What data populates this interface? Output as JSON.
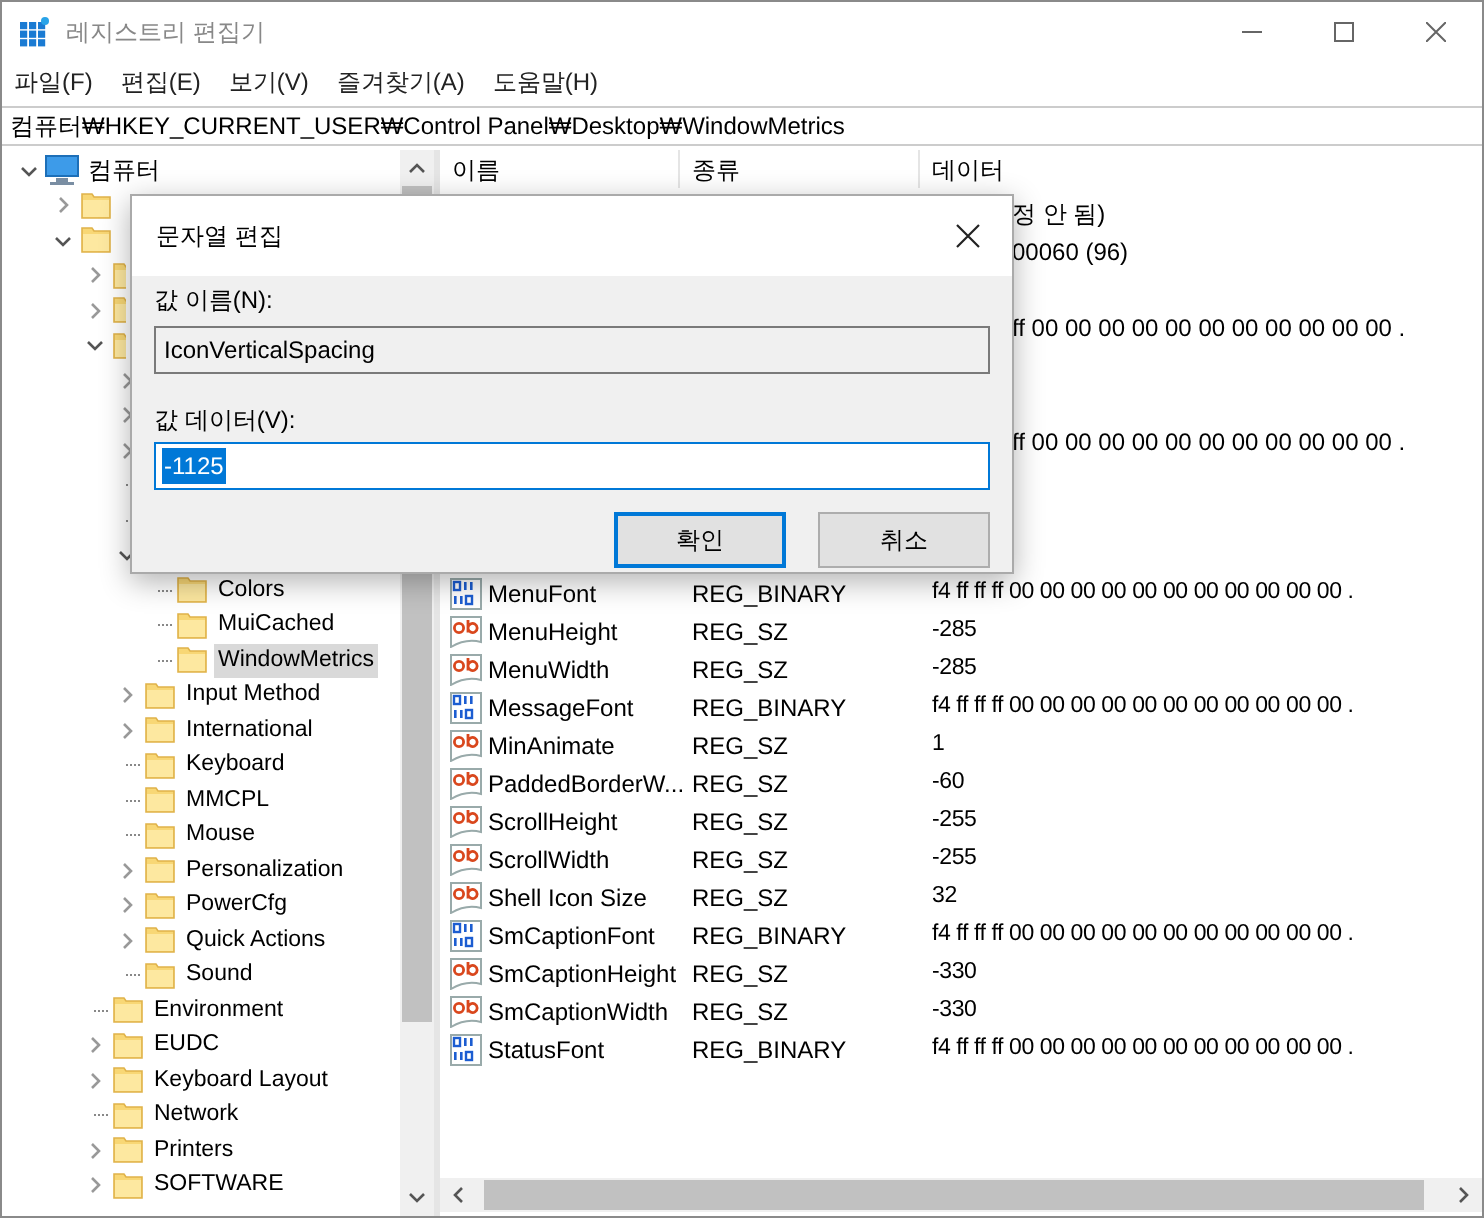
{
  "window": {
    "title": "레지스트리 편집기"
  },
  "menu": [
    "파일(F)",
    "편집(E)",
    "보기(V)",
    "즐겨찾기(A)",
    "도움말(H)"
  ],
  "address": "컴퓨터₩HKEY_CURRENT_USER₩Control Panel₩Desktop₩WindowMetrics",
  "tree": {
    "root": {
      "label": "컴퓨터",
      "expanded": true
    },
    "items": [
      {
        "expanded": false
      },
      {
        "expanded": true,
        "children": [
          {
            "expanded": false
          },
          {
            "expanded": false
          },
          {
            "expanded": true,
            "children": [
              {
                "expanded": false
              },
              {
                "expanded": false
              },
              {
                "expanded": false
              },
              {
                "leaf": true
              },
              {
                "leaf": true
              },
              {
                "expanded": true,
                "children": [
                  {
                    "label": "Colors",
                    "selected": false
                  },
                  {
                    "label": "MuiCached",
                    "selected": false
                  },
                  {
                    "label": "WindowMetrics",
                    "selected": true
                  }
                ]
              },
              {
                "label": "Input Method",
                "expanded": false,
                "selected": false
              },
              {
                "label": "International",
                "expanded": false,
                "selected": false
              },
              {
                "label": "Keyboard",
                "selected": false
              },
              {
                "label": "MMCPL",
                "selected": false
              },
              {
                "label": "Mouse",
                "selected": false
              },
              {
                "label": "Personalization",
                "expanded": false,
                "selected": false
              },
              {
                "label": "PowerCfg",
                "expanded": false,
                "selected": false
              },
              {
                "label": "Quick Actions",
                "expanded": false,
                "selected": false
              },
              {
                "label": "Sound",
                "selected": false
              }
            ]
          },
          {
            "label": "Environment",
            "selected": false
          },
          {
            "label": "EUDC",
            "expanded": false,
            "selected": false
          },
          {
            "label": "Keyboard Layout",
            "expanded": false,
            "selected": false
          },
          {
            "label": "Network",
            "selected": false
          },
          {
            "label": "Printers",
            "expanded": false,
            "selected": false
          },
          {
            "label": "SOFTWARE",
            "expanded": false,
            "selected": false
          }
        ]
      }
    ]
  },
  "table": {
    "columns": [
      "이름",
      "종류",
      "데이터"
    ],
    "rows": [
      {
        "kind": "covered",
        "data": "정 안 됨)"
      },
      {
        "kind": "covered",
        "data": "00060 (96)"
      },
      {
        "kind": "covered"
      },
      {
        "kind": "covered",
        "data": "ff 00 00 00 00 00 00 00 00 00 00 00 ."
      },
      {
        "kind": "covered"
      },
      {
        "kind": "covered"
      },
      {
        "kind": "covered",
        "data": "ff 00 00 00 00 00 00 00 00 00 00 00 ."
      },
      {
        "kind": "covered"
      },
      {
        "kind": "covered"
      },
      {
        "kind": "covered"
      },
      {
        "kind": "binary",
        "name": "MenuFont",
        "type": "REG_BINARY",
        "data": "f4 ff ff ff 00 00 00 00 00 00 00 00 00 00 00 ."
      },
      {
        "kind": "string",
        "name": "MenuHeight",
        "type": "REG_SZ",
        "data": "-285"
      },
      {
        "kind": "string",
        "name": "MenuWidth",
        "type": "REG_SZ",
        "data": "-285"
      },
      {
        "kind": "binary",
        "name": "MessageFont",
        "type": "REG_BINARY",
        "data": "f4 ff ff ff 00 00 00 00 00 00 00 00 00 00 00 ."
      },
      {
        "kind": "string",
        "name": "MinAnimate",
        "type": "REG_SZ",
        "data": "1"
      },
      {
        "kind": "string",
        "name": "PaddedBorderW...",
        "type": "REG_SZ",
        "data": "-60"
      },
      {
        "kind": "string",
        "name": "ScrollHeight",
        "type": "REG_SZ",
        "data": "-255"
      },
      {
        "kind": "string",
        "name": "ScrollWidth",
        "type": "REG_SZ",
        "data": "-255"
      },
      {
        "kind": "string",
        "name": "Shell Icon Size",
        "type": "REG_SZ",
        "data": "32"
      },
      {
        "kind": "binary",
        "name": "SmCaptionFont",
        "type": "REG_BINARY",
        "data": "f4 ff ff ff 00 00 00 00 00 00 00 00 00 00 00 ."
      },
      {
        "kind": "string",
        "name": "SmCaptionHeight",
        "type": "REG_SZ",
        "data": "-330"
      },
      {
        "kind": "string",
        "name": "SmCaptionWidth",
        "type": "REG_SZ",
        "data": "-330"
      },
      {
        "kind": "binary",
        "name": "StatusFont",
        "type": "REG_BINARY",
        "data": "f4 ff ff ff 00 00 00 00 00 00 00 00 00 00 00 ."
      }
    ]
  },
  "dialog": {
    "title": "문자열 편집",
    "name_label": "값 이름(N):",
    "name_value": "IconVerticalSpacing",
    "data_label": "값 데이터(V):",
    "data_value": "-1125",
    "buttons": [
      {
        "label": "확인",
        "default": true
      },
      {
        "label": "취소",
        "default": false
      }
    ]
  }
}
